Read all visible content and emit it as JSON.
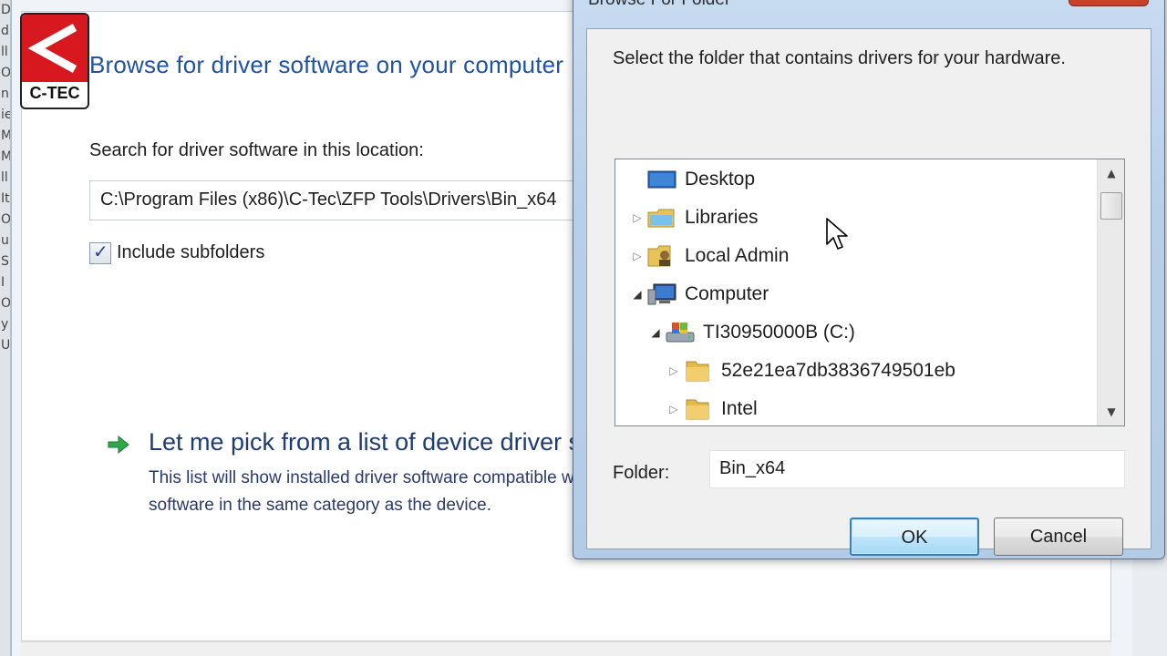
{
  "background_window": {
    "edge_glyphs": [
      "Di",
      "di",
      "ll",
      "O",
      "n",
      "ie",
      "M",
      "M",
      "ll",
      "It",
      "O",
      "u",
      "S",
      "I",
      "O",
      "y",
      "Ui"
    ],
    "logo_text": "C-TEC",
    "heading": "Browse for driver software on your computer",
    "search_label": "Search for driver software in this location:",
    "path_value": "C:\\Program Files (x86)\\C-Tec\\ZFP Tools\\Drivers\\Bin_x64",
    "include_subfolders_label": "Include subfolders",
    "include_subfolders_checked": true,
    "pick_title": "Let me pick from a list of device driver software on my computer",
    "pick_desc_line1": "This list will show installed driver software compatible with the device, and all driver",
    "pick_desc_line2": "software in the same category as the device."
  },
  "dialog": {
    "title": "Browse For Folder",
    "prompt": "Select the folder that contains drivers for your hardware.",
    "tree": [
      {
        "label": "Desktop",
        "icon": "desktop-icon",
        "toggle": "none",
        "level": 0
      },
      {
        "label": "Libraries",
        "icon": "libraries-icon",
        "toggle": "collapsed",
        "level": 0
      },
      {
        "label": "Local Admin",
        "icon": "user-folder-icon",
        "toggle": "collapsed",
        "level": 0
      },
      {
        "label": "Computer",
        "icon": "computer-icon",
        "toggle": "expanded",
        "level": 0
      },
      {
        "label": "TI30950000B (C:)",
        "icon": "drive-icon",
        "toggle": "expanded",
        "level": 1
      },
      {
        "label": "52e21ea7db3836749501eb",
        "icon": "folder-icon",
        "toggle": "collapsed",
        "level": 2
      },
      {
        "label": "Intel",
        "icon": "folder-icon",
        "toggle": "collapsed",
        "level": 2
      }
    ],
    "folder_label": "Folder:",
    "folder_value": "Bin_x64",
    "ok_label": "OK",
    "cancel_label": "Cancel"
  },
  "colors": {
    "heading_blue": "#1f53a3",
    "logo_red": "#d7191f",
    "arrow_green": "#2ea84a"
  }
}
